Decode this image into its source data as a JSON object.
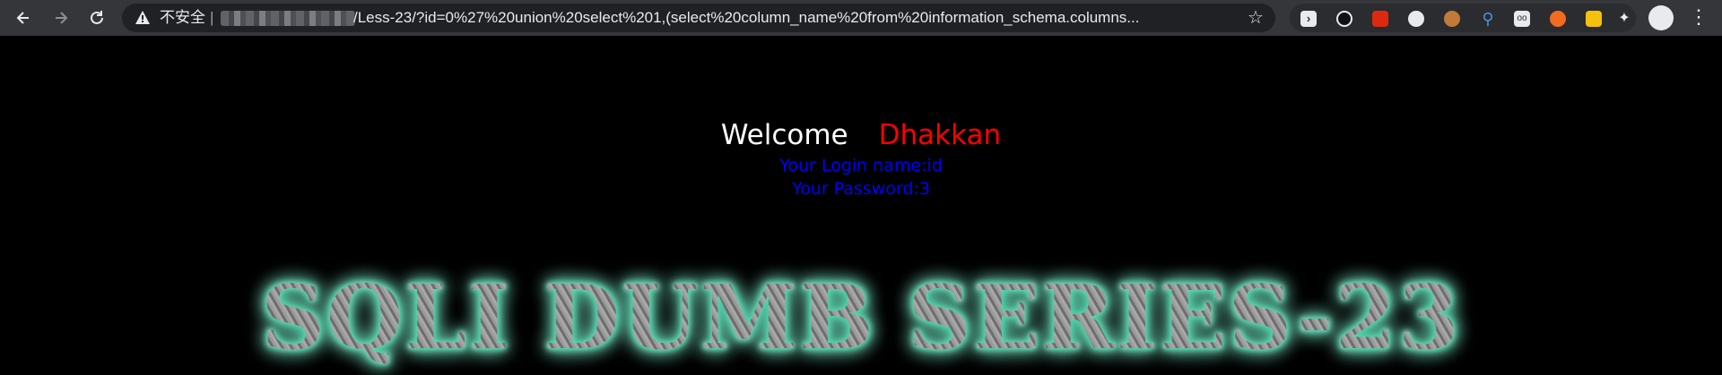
{
  "browser": {
    "nav": {
      "back_icon": "arrow-left-icon",
      "forward_icon": "arrow-right-icon",
      "reload_icon": "reload-icon"
    },
    "omnibox": {
      "security_label": "不安全",
      "separator": "|",
      "url_tail": "/Less-23/?id=0%27%20union%20select%201,(select%20column_name%20from%20information_schema.columns...",
      "star_icon": "star-icon"
    },
    "extensions": [
      {
        "icon": "sidebar-extension-icon",
        "color": "#e8eaed"
      },
      {
        "icon": "circle-extension-icon",
        "color": "#111111"
      },
      {
        "icon": "flag-extension-icon",
        "color": "#de2910"
      },
      {
        "icon": "cloud-extension-icon",
        "color": "#e8eaed"
      },
      {
        "icon": "cookie-extension-icon",
        "color": "#c27a3a"
      },
      {
        "icon": "location-pin-extension-icon",
        "color": "#4a90e2"
      },
      {
        "icon": "glasses-extension-icon",
        "color": "#e8eaed"
      },
      {
        "icon": "target-extension-icon",
        "color": "#f26b21"
      },
      {
        "icon": "animal-extension-icon",
        "color": "#f4c20d"
      },
      {
        "icon": "puzzle-extension-icon",
        "color": "#e8eaed"
      }
    ],
    "menu_icon": "more-vertical-icon"
  },
  "page": {
    "welcome_label": "Welcome",
    "welcome_name": "Dhakkan",
    "login_line": "Your Login name:id",
    "password_line": "Your Password:3",
    "title": "SQLI DUMB SERIES-23",
    "colors": {
      "background": "#000000",
      "welcome": "#ffffff",
      "name": "#ff0000",
      "info": "#0000ff",
      "glow": "#4de0b0"
    }
  }
}
